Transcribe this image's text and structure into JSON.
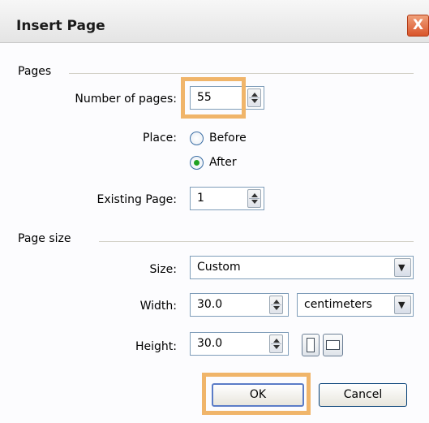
{
  "dialog": {
    "title": "Insert Page",
    "close_label": "X"
  },
  "pages_group": {
    "label": "Pages",
    "number_of_pages_label": "Number of pages:",
    "number_of_pages_value": "55",
    "place_label": "Place:",
    "place_options": [
      {
        "label": "Before",
        "selected": false
      },
      {
        "label": "After",
        "selected": true
      }
    ],
    "existing_page_label": "Existing Page:",
    "existing_page_value": "1"
  },
  "page_size_group": {
    "label": "Page size",
    "size_label": "Size:",
    "size_value": "Custom",
    "width_label": "Width:",
    "width_value": "30.0",
    "units_value": "centimeters",
    "height_label": "Height:",
    "height_value": "30.0"
  },
  "buttons": {
    "ok": "OK",
    "cancel": "Cancel"
  },
  "colors": {
    "highlight": "#f0b56a",
    "radio_selected": "#21a121",
    "close_button": "#d9542b"
  }
}
